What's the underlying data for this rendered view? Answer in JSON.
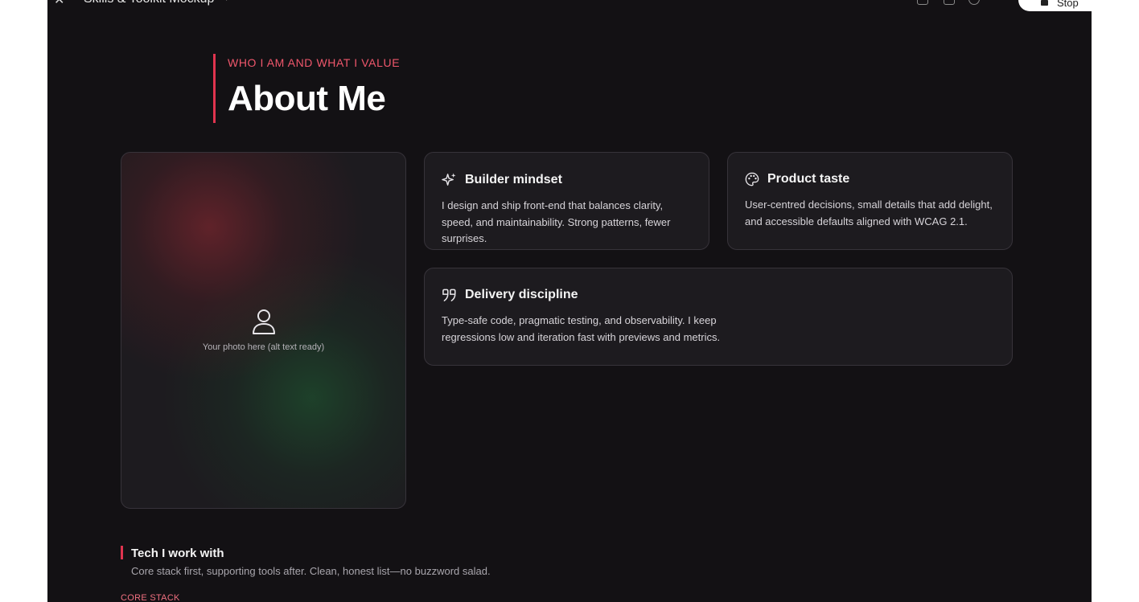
{
  "window": {
    "title": "Skills & Toolkit Mockup",
    "stop_label": "Stop"
  },
  "hero": {
    "eyebrow": "WHO I AM AND WHAT I VALUE",
    "title": "About Me"
  },
  "photo": {
    "caption": "Your photo here (alt text ready)",
    "icon": "user-icon"
  },
  "cards": [
    {
      "icon": "sparkles-icon",
      "title": "Builder mindset",
      "text": "I design and ship front-end that balances clarity, speed, and maintainability. Strong patterns, fewer surprises."
    },
    {
      "icon": "palette-icon",
      "title": "Product taste",
      "text": "User-centred decisions, small details that add delight, and accessible defaults aligned with WCAG 2.1."
    },
    {
      "icon": "quote-icon",
      "title": "Delivery discipline",
      "text": "Type-safe code, pragmatic testing, and observability. I keep regressions low and iteration fast with previews and metrics."
    }
  ],
  "tech": {
    "title": "Tech I work with",
    "subtitle": "Core stack first, supporting tools after. Clean, honest list—no buzzword salad.",
    "core_label": "CORE STACK"
  },
  "colors": {
    "accent": "#e0344f",
    "background": "#131114",
    "card": "#1d1b1f"
  }
}
